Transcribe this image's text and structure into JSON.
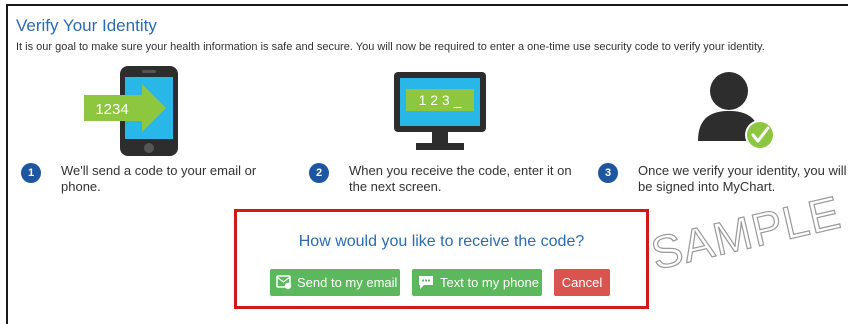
{
  "page": {
    "title": "Verify Your Identity",
    "subtitle": "It is our goal to make sure your health information is safe and secure. You will now be required to enter a one-time use security code to verify your identity."
  },
  "steps": [
    {
      "number": "1",
      "text": "We'll send a code to your email or phone.",
      "illustration_text": "1234",
      "icon": "phone-icon"
    },
    {
      "number": "2",
      "text": "When you receive the code, enter it on the next screen.",
      "illustration_text": "1 2 3 _",
      "icon": "monitor-icon"
    },
    {
      "number": "3",
      "text": "Once we verify your identity, you will be signed into MyChart.",
      "icon": "verified-user-icon"
    }
  ],
  "prompt": {
    "question": "How would you like to receive the code?",
    "email_button": "Send to my email",
    "phone_button": "Text to my phone",
    "cancel_button": "Cancel"
  },
  "watermark": "SAMPLE",
  "colors": {
    "title_blue": "#2b6cb0",
    "step_badge": "#1e56a0",
    "green": "#5cb85c",
    "green_arrow": "#8dc63f",
    "red_button": "#d9534f",
    "highlight_border": "#d01a1a",
    "screen_blue": "#29b6e8"
  }
}
